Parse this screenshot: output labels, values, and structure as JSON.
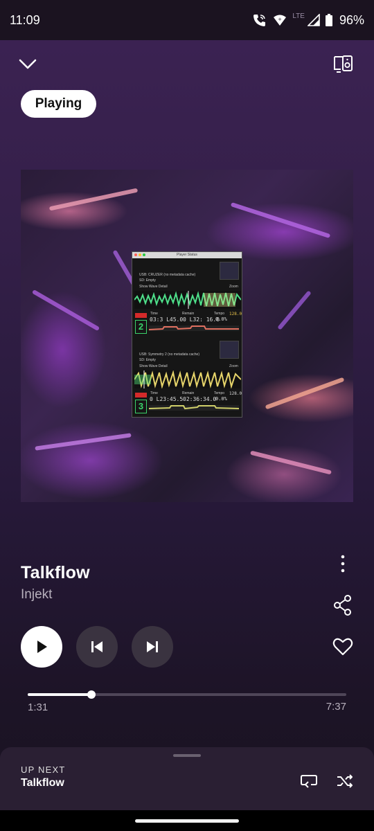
{
  "status_bar": {
    "time": "11:09",
    "network": "LTE",
    "battery": "96%",
    "icons": [
      "wifi-calling-icon",
      "wifi-icon",
      "cell-signal-icon",
      "battery-icon"
    ]
  },
  "header": {
    "collapse_icon": "chevron-down-icon",
    "device_icon": "connect-device-icon"
  },
  "chip": {
    "label": "Playing"
  },
  "cover_art": {
    "window_title": "Player Status",
    "deck1": {
      "source": "USB: CRUZER (no metadata cache)",
      "sd": "SD: Empty",
      "wave_label": "Show Wave Detail",
      "zoom": "Zoom",
      "time_label": "Time",
      "remain_label": "Remain",
      "tempo_label": "Tempo",
      "time": "03:3 L45.0",
      "remain": "0 L32: 16.0",
      "tempo": "0.0%",
      "bpm": "128.0",
      "player": "2"
    },
    "deck2": {
      "source": "USB: Symmetry 2 (no metadata cache)",
      "sd": "SD: Empty",
      "wave_label": "Show Wave Detail",
      "zoom": "Zoom",
      "time_label": "Time",
      "remain_label": "Remain",
      "tempo_label": "Tempo",
      "time": "0 L23:45.5",
      "remain": "02:36:34.0",
      "tempo": "0.0%",
      "bpm": "128.0",
      "player": "3"
    }
  },
  "track": {
    "title": "Talkflow",
    "artist": "Injekt"
  },
  "controls": {
    "play_icon": "play-icon",
    "prev_icon": "skip-previous-icon",
    "next_icon": "skip-next-icon",
    "more_icon": "more-vertical-icon",
    "share_icon": "share-icon",
    "like_icon": "heart-icon"
  },
  "progress": {
    "elapsed": "1:31",
    "total": "7:37",
    "fraction": 0.199
  },
  "up_next": {
    "label": "UP NEXT",
    "title": "Talkflow",
    "queue_icon": "queue-icon",
    "shuffle_icon": "shuffle-icon"
  },
  "colors": {
    "background_top": "#3b2252",
    "background_bottom": "#181220",
    "panel": "#2a1f33",
    "control_bg": "#3a3340",
    "progress_track": "#4f4658",
    "secondary_text": "#b8b1bd"
  }
}
